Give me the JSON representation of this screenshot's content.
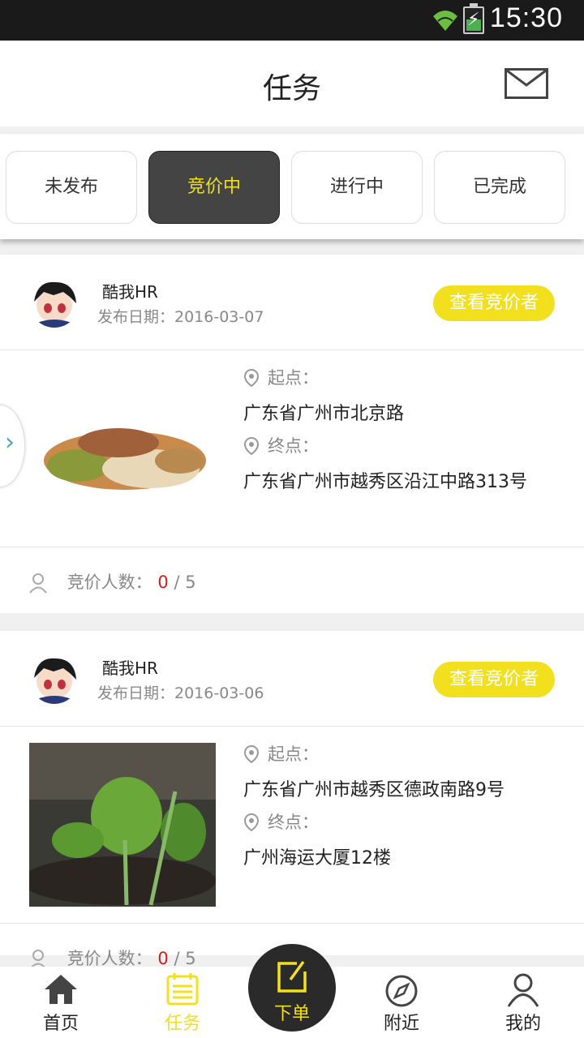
{
  "status_bar": {
    "time": "15:30"
  },
  "header": {
    "title": "任务"
  },
  "tabs": [
    {
      "label": "未发布",
      "active": false
    },
    {
      "label": "竞价中",
      "active": true
    },
    {
      "label": "进行中",
      "active": false
    },
    {
      "label": "已完成",
      "active": false
    }
  ],
  "tasks": [
    {
      "poster": "酷我HR",
      "date": "发布日期：2016-03-07",
      "view_bidders_label": "查看竞价者",
      "start_label": "起点：",
      "start_address": "广东省广州市北京路",
      "end_label": "终点：",
      "end_address": "广东省广州市越秀区沿江中路313号",
      "bid_count_label": "竞价人数：",
      "bid_count": "0",
      "bid_total": "/ 5"
    },
    {
      "poster": "酷我HR",
      "date": "发布日期：2016-03-06",
      "view_bidders_label": "查看竞价者",
      "start_label": "起点：",
      "start_address": "广东省广州市越秀区德政南路9号",
      "end_label": "终点：",
      "end_address": "广州海运大厦12楼",
      "bid_count_label": "竞价人数：",
      "bid_count": "0",
      "bid_total": "/ 5"
    }
  ],
  "bottom_nav": [
    {
      "label": "首页",
      "icon": "home-icon",
      "active": false
    },
    {
      "label": "任务",
      "icon": "task-list-icon",
      "active": true
    },
    {
      "label": "下单",
      "icon": "edit-icon",
      "active": false
    },
    {
      "label": "附近",
      "icon": "compass-icon",
      "active": false
    },
    {
      "label": "我的",
      "icon": "user-icon",
      "active": false
    }
  ],
  "colors": {
    "accent": "#f2e01f",
    "dark": "#2a2a2a",
    "count_red": "#d0201a"
  }
}
